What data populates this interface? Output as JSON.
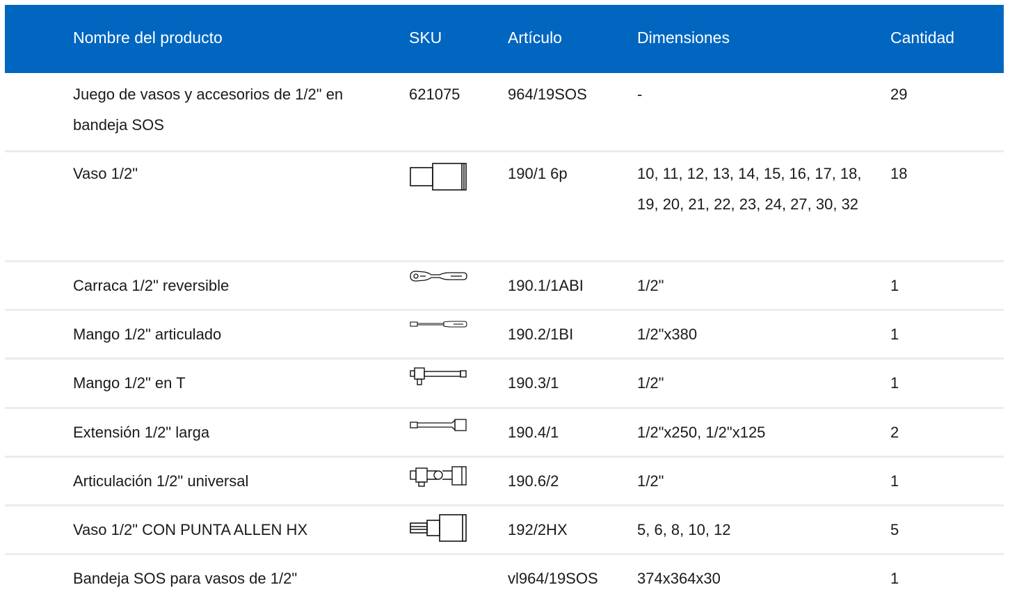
{
  "headers": {
    "name": "Nombre del producto",
    "sku": "SKU",
    "article": "Artículo",
    "dimensions": "Dimensiones",
    "quantity": "Cantidad"
  },
  "rows": [
    {
      "name": "Juego de vasos y accesorios de 1/2\" en bandeja SOS",
      "sku": "621075",
      "icon": "",
      "article": "964/19SOS",
      "dimensions": "-",
      "quantity": "29"
    },
    {
      "name": "Vaso 1/2\"",
      "sku": "",
      "icon": "socket-icon",
      "article": "190/1 6p",
      "dimensions": "10, 11, 12, 13, 14, 15, 16, 17, 18, 19, 20, 21, 22, 23, 24, 27, 30, 32",
      "quantity": "18"
    },
    {
      "name": "Carraca 1/2\" reversible",
      "sku": "",
      "icon": "ratchet-icon",
      "article": "190.1/1ABI",
      "dimensions": "1/2\"",
      "quantity": "1"
    },
    {
      "name": "Mango 1/2\" articulado",
      "sku": "",
      "icon": "breaker-bar-icon",
      "article": "190.2/1BI",
      "dimensions": "1/2\"x380",
      "quantity": "1"
    },
    {
      "name": "Mango 1/2\" en T",
      "sku": "",
      "icon": "t-handle-icon",
      "article": "190.3/1",
      "dimensions": "1/2\"",
      "quantity": "1"
    },
    {
      "name": "Extensión 1/2\" larga",
      "sku": "",
      "icon": "extension-bar-icon",
      "article": "190.4/1",
      "dimensions": "1/2\"x250, 1/2\"x125",
      "quantity": "2"
    },
    {
      "name": "Articulación 1/2\" universal",
      "sku": "",
      "icon": "universal-joint-icon",
      "article": "190.6/2",
      "dimensions": "1/2\"",
      "quantity": "1"
    },
    {
      "name": "Vaso 1/2\" CON PUNTA ALLEN HX",
      "sku": "",
      "icon": "hex-bit-socket-icon",
      "article": "192/2HX",
      "dimensions": "5, 6, 8, 10, 12",
      "quantity": "5"
    },
    {
      "name": "Bandeja SOS para vasos de 1/2\"",
      "sku": "",
      "icon": "",
      "article": "vl964/19SOS",
      "dimensions": "374x364x30",
      "quantity": "1"
    }
  ],
  "colors": {
    "header_bg": "#0066c0",
    "header_text": "#ffffff",
    "divider": "#ececec"
  }
}
